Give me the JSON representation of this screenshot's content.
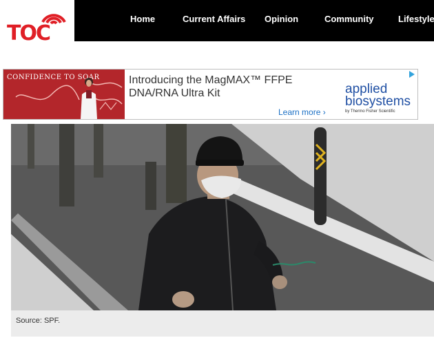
{
  "site": {
    "logo_text": "TOC"
  },
  "nav": {
    "items": [
      {
        "label": "Home"
      },
      {
        "label": "Current Affairs"
      },
      {
        "label": "Opinion"
      },
      {
        "label": "Community"
      },
      {
        "label": "Lifestyle"
      }
    ]
  },
  "ad": {
    "tagline": "CONFIDENCE TO SOAR",
    "headline": "Introducing the MagMAX™ FFPE DNA/RNA Ultra Kit",
    "cta": "Learn more ›",
    "brand_line1": "applied",
    "brand_line2": "biosystems",
    "brand_sub": "by Thermo Fisher Scientific",
    "accent_color": "#b3262b",
    "brand_color": "#1f4fa3"
  },
  "article": {
    "image_caption": "Source: SPF."
  },
  "colors": {
    "header_bg": "#000000",
    "logo_red": "#e01f26"
  }
}
